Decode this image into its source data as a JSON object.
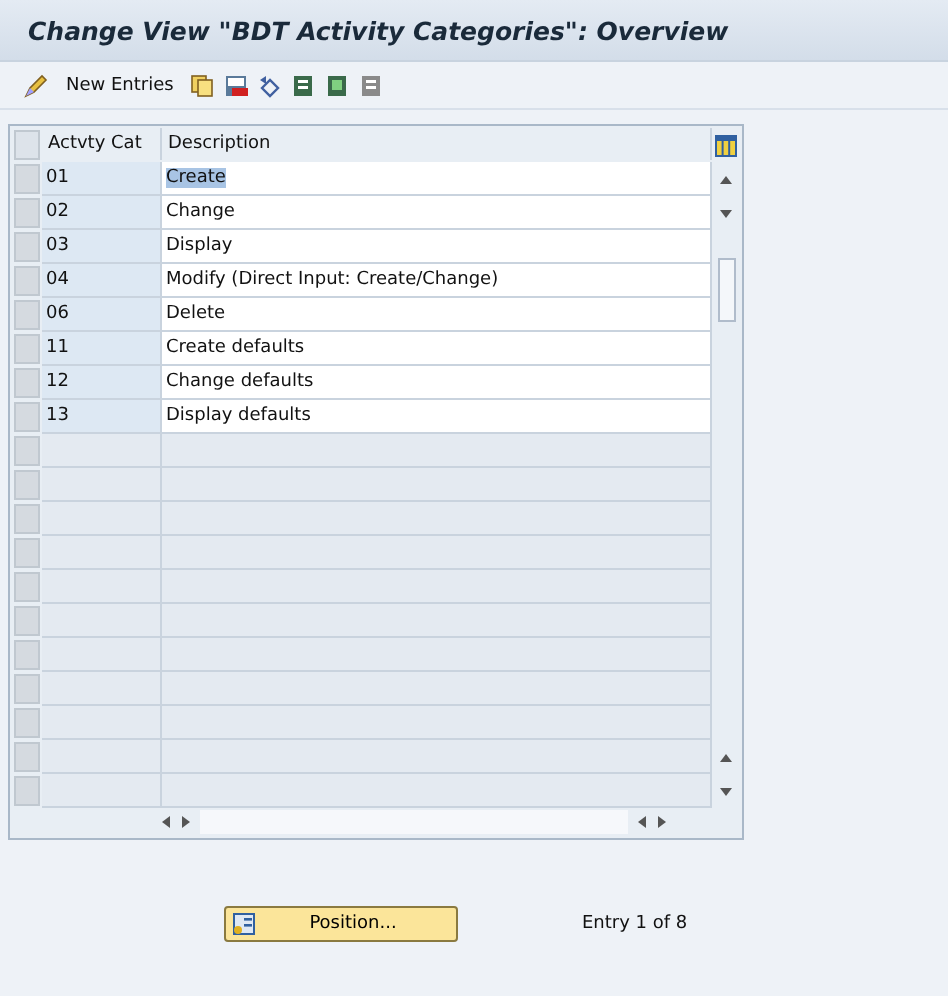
{
  "window": {
    "title": "Change View \"BDT Activity Categories\": Overview"
  },
  "toolbar": {
    "new_entries": "New Entries"
  },
  "table": {
    "columns": [
      "Actvty Cat",
      "Description"
    ],
    "rows": [
      {
        "cells": [
          "01",
          "Create"
        ],
        "selected": true
      },
      {
        "cells": [
          "02",
          "Change"
        ],
        "selected": false
      },
      {
        "cells": [
          "03",
          "Display"
        ],
        "selected": false
      },
      {
        "cells": [
          "04",
          "Modify (Direct Input: Create/Change)"
        ],
        "selected": false
      },
      {
        "cells": [
          "06",
          "Delete"
        ],
        "selected": false
      },
      {
        "cells": [
          "11",
          "Create defaults"
        ],
        "selected": false
      },
      {
        "cells": [
          "12",
          "Change defaults"
        ],
        "selected": false
      },
      {
        "cells": [
          "13",
          "Display defaults"
        ],
        "selected": false
      }
    ]
  },
  "footer": {
    "position_button": "Position...",
    "entry_count": "Entry 1 of 8"
  }
}
